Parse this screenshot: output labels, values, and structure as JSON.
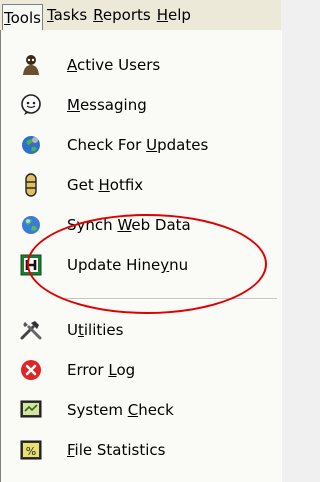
{
  "menubar": {
    "items": [
      {
        "label": "Tools",
        "underline_index": 0
      },
      {
        "label": "Tasks",
        "underline_index": 0
      },
      {
        "label": "Reports",
        "underline_index": 0
      },
      {
        "label": "Help",
        "underline_index": 0
      }
    ]
  },
  "tools_menu": {
    "items": [
      {
        "label": "Active Users",
        "underline": "A",
        "icon": "active-users-icon"
      },
      {
        "label": "Messaging",
        "underline": "M",
        "icon": "messaging-icon"
      },
      {
        "label": "Check For Updates",
        "underline": "U",
        "icon": "check-for-updates-icon"
      },
      {
        "label": "Get Hotfix",
        "underline": "H",
        "icon": "hotfix-icon"
      },
      {
        "label": "Synch Web Data",
        "underline": "W",
        "icon": "globe-icon"
      },
      {
        "label": "Update Hineynu",
        "underline": "y",
        "icon": "update-h-icon"
      },
      {
        "label": "Utilities",
        "underline": "t",
        "icon": "tools-icon"
      },
      {
        "label": "Error Log",
        "underline": "L",
        "icon": "error-icon"
      },
      {
        "label": "System Check",
        "underline": "C",
        "icon": "system-check-icon"
      },
      {
        "label": "File Statistics",
        "underline": "F",
        "icon": "file-statistics-icon"
      }
    ]
  },
  "annotation": {
    "color": "#e00000"
  }
}
